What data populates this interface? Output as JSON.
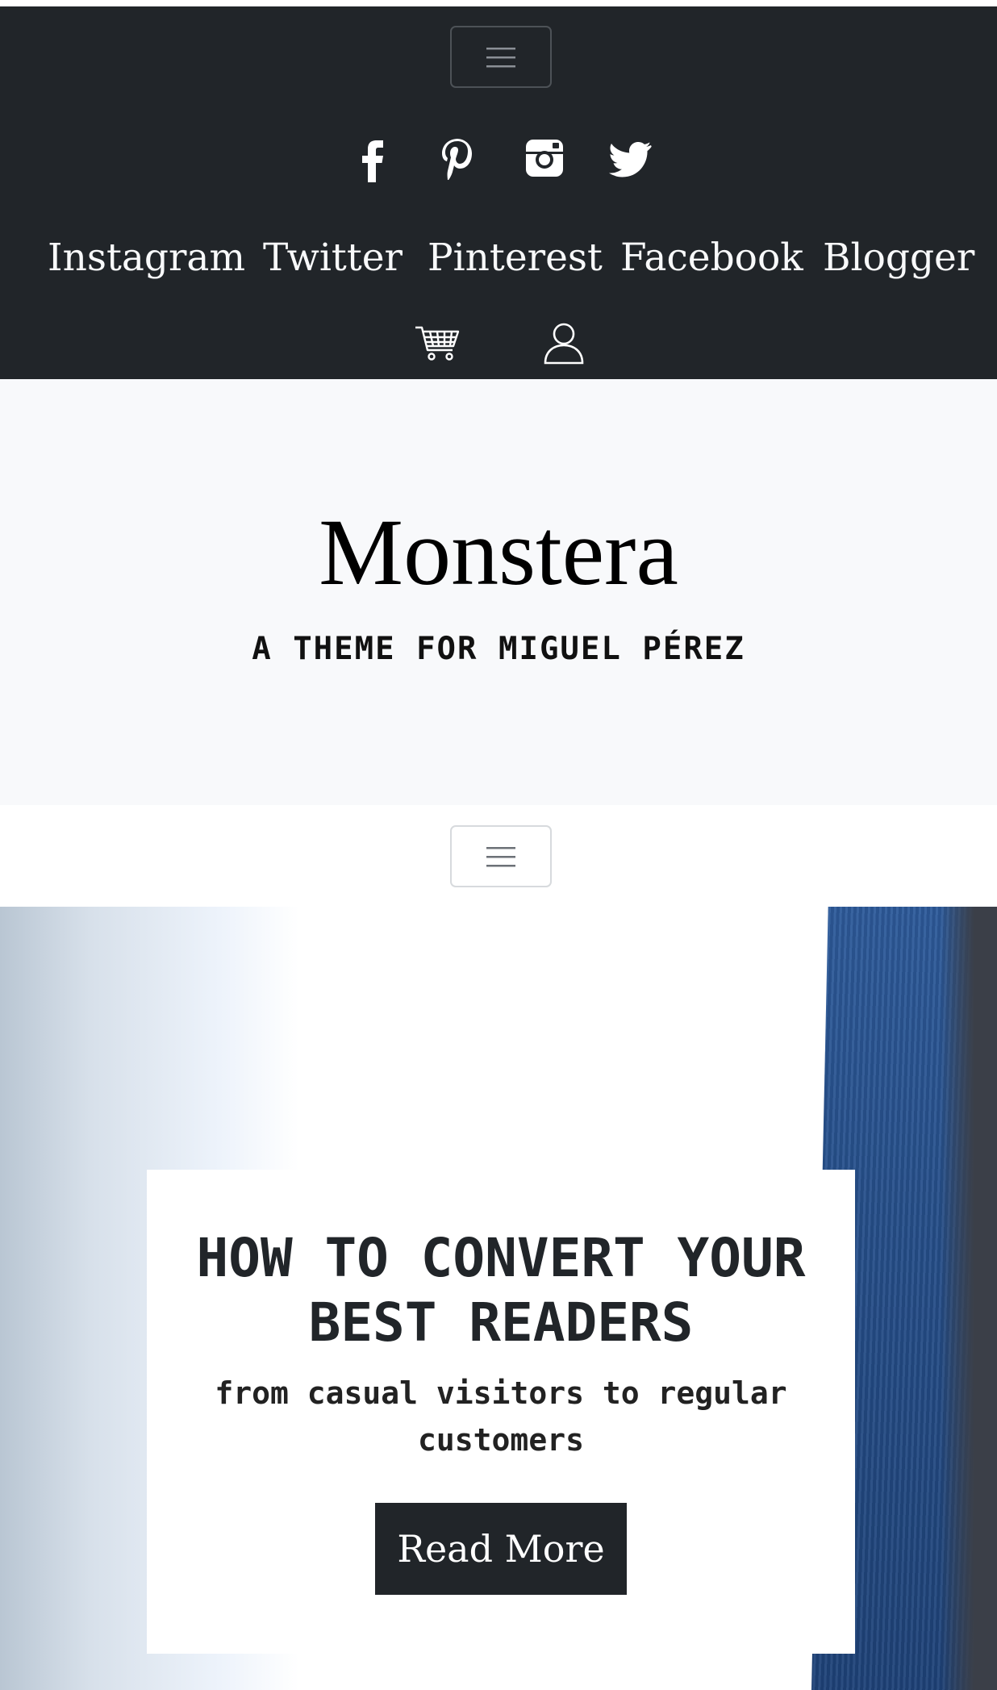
{
  "topbar": {
    "menu_toggle_icon": "hamburger-icon",
    "social_icons": [
      "facebook-icon",
      "pinterest-icon",
      "instagram-icon",
      "twitter-icon"
    ],
    "nav_links": [
      "Instagram",
      "Twitter",
      "Pinterest",
      "Facebook",
      "Blogger"
    ],
    "utility_icons": [
      "cart-icon",
      "user-icon"
    ],
    "colors": {
      "background": "#212529",
      "text": "#f8f9fa"
    }
  },
  "hero": {
    "title": "Monstera",
    "tagline": "A THEME FOR MIGUEL PÉREZ"
  },
  "secondary_nav": {
    "menu_toggle_icon": "hamburger-icon"
  },
  "feature": {
    "title": "HOW TO CONVERT YOUR BEST READERS",
    "subtitle": "from casual visitors to regular customers",
    "button_label": "Read More",
    "colors": {
      "button": "#212529",
      "accent_blue": "#2d5a9a"
    }
  }
}
